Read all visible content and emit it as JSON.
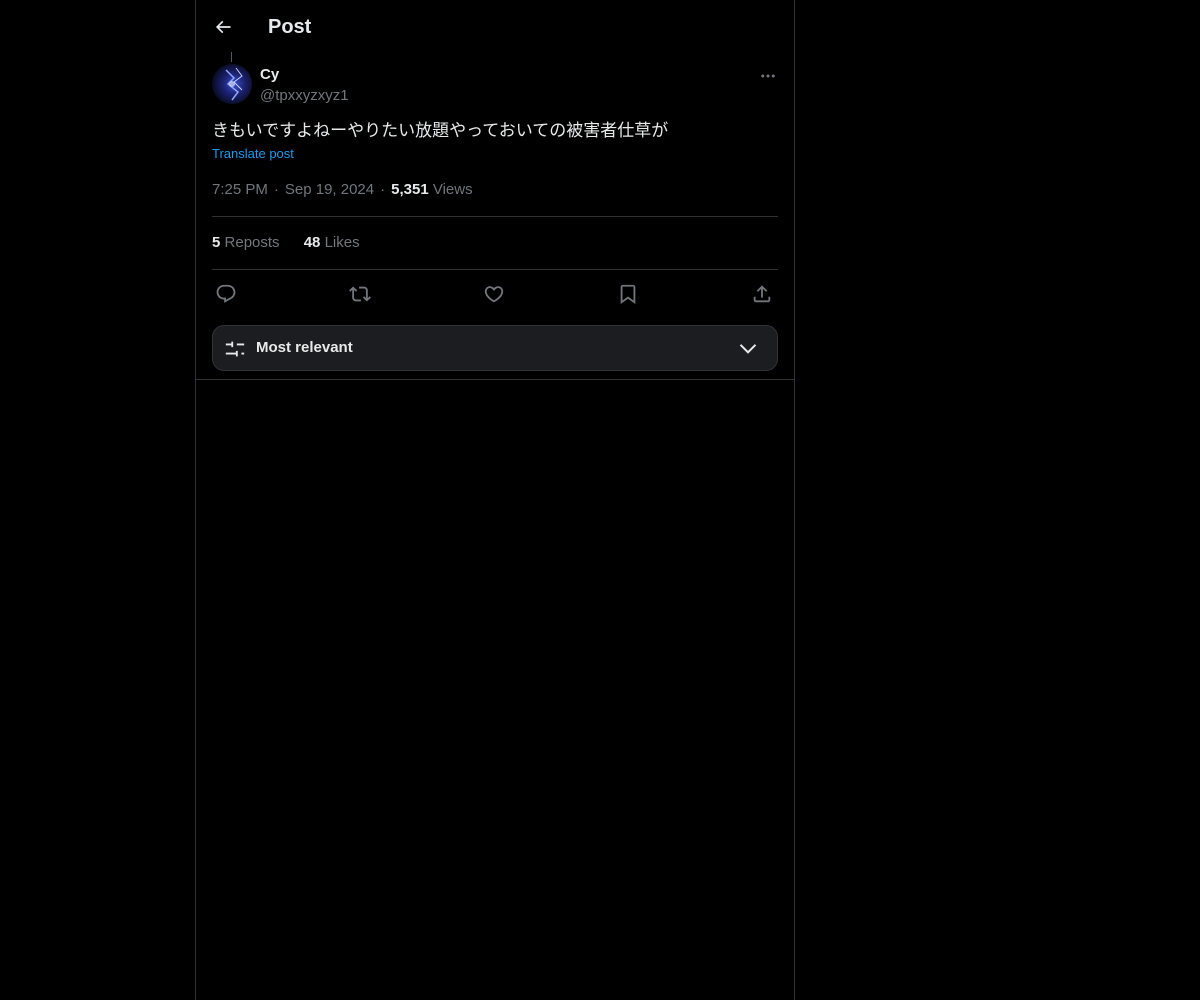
{
  "header": {
    "back_icon": "arrow-left-icon",
    "title": "Post"
  },
  "post": {
    "author": {
      "display_name": "Cy",
      "handle": "@tpxxyzxyz1"
    },
    "text": "きもいですよねーやりたい放題やっておいての被害者仕草が",
    "translate_label": "Translate post",
    "time": "7:25 PM",
    "date": "Sep 19, 2024",
    "views_count": "5,351",
    "views_label": "Views",
    "reposts_count": "5",
    "reposts_label": "Reposts",
    "likes_count": "48",
    "likes_label": "Likes"
  },
  "actions": {
    "icons": [
      "reply-icon",
      "repost-icon",
      "like-icon",
      "bookmark-icon",
      "share-icon"
    ]
  },
  "sort": {
    "label": "Most relevant",
    "icon": "sliders-icon"
  },
  "colors": {
    "background": "#000000",
    "text": "#e7e9ea",
    "muted": "#71767b",
    "link": "#1d9bf0",
    "border": "#2f3336"
  }
}
